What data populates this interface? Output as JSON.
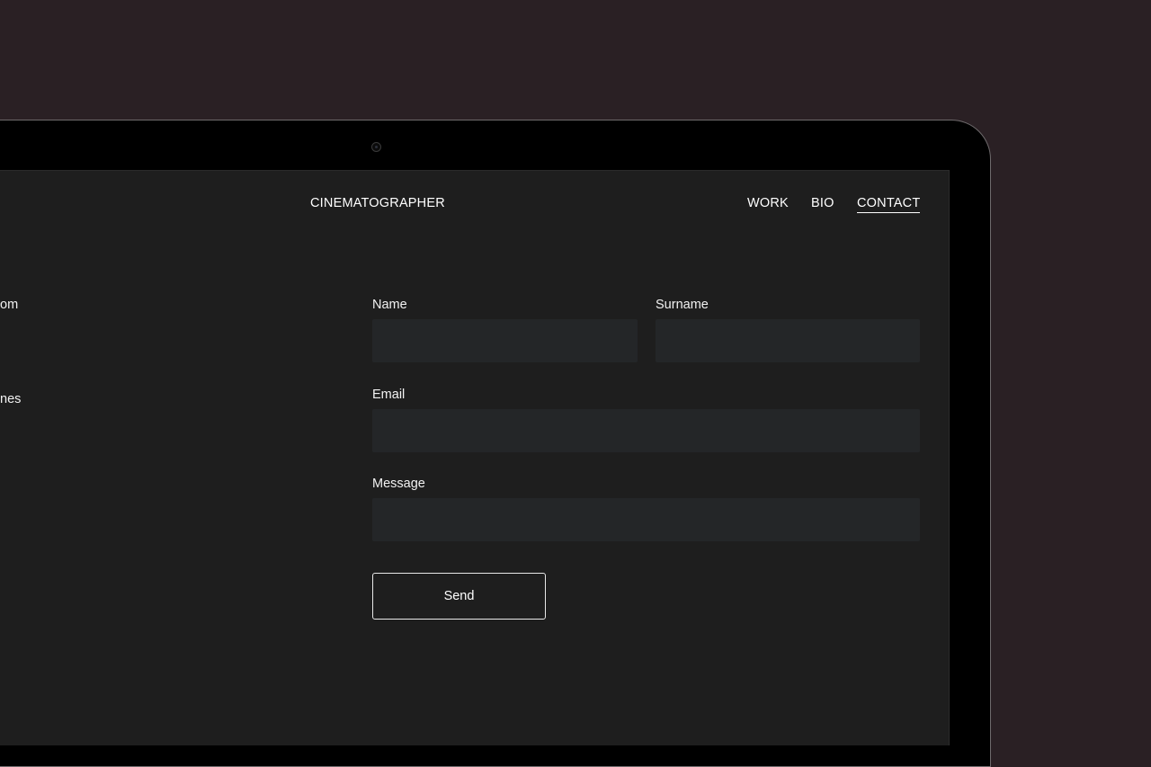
{
  "header": {
    "brand": "CINEMATOGRAPHER",
    "nav": [
      {
        "label": "WORK"
      },
      {
        "label": "BIO"
      },
      {
        "label": "CONTACT",
        "active": true
      }
    ]
  },
  "left_column": {
    "fragments": [
      "om",
      "nes"
    ]
  },
  "form": {
    "name": {
      "label": "Name",
      "value": "",
      "placeholder": ""
    },
    "surname": {
      "label": "Surname",
      "value": "",
      "placeholder": ""
    },
    "email": {
      "label": "Email",
      "value": "",
      "placeholder": ""
    },
    "message": {
      "label": "Message",
      "value": "",
      "placeholder": ""
    },
    "submit_label": "Send"
  },
  "colors": {
    "backdrop": "#2a2024",
    "screen_bg": "#1e1e1e",
    "field_bg": "#242628",
    "text": "#ffffff"
  }
}
